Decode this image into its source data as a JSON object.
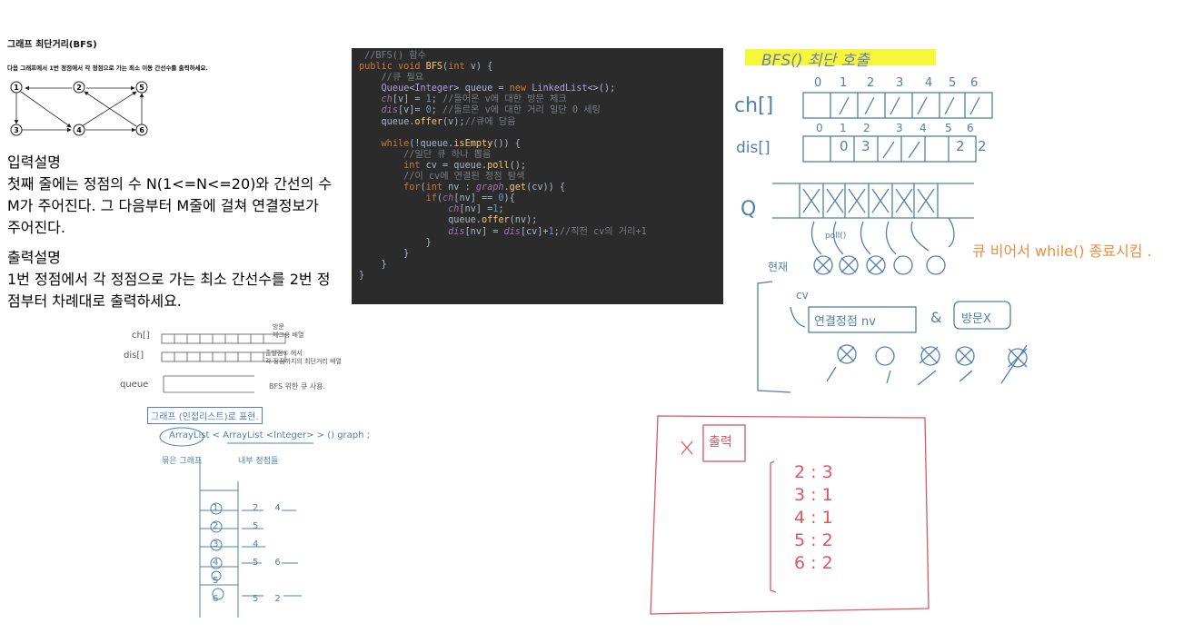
{
  "problem": {
    "title": "그래프 최단거리(BFS)",
    "description": "다음 그래프에서 1번 정점에서 각 정점으로 가는 최소 이동 간선수를 출력하세요.",
    "nodes": [
      "1",
      "2",
      "5",
      "3",
      "4",
      "6"
    ],
    "input_heading": "입력설명",
    "input_text": "첫째 줄에는 정점의 수 N(1<=N<=20)와 간선의 수 M가 주어진다. 그 다음부터 M줄에 걸쳐 연결정보가 주어진다.",
    "output_heading": "출력설명",
    "output_text": "1번 정점에서 각 정점으로 가는 최소 간선수를 2번 정점부터 차례대로 출력하세요."
  },
  "code": {
    "lines": [
      "//BFS() 함수",
      "public void BFS(int v) {",
      "    //큐 필요",
      "    Queue<Integer> queue = new LinkedList<>();",
      "    ch[v] = 1; //들어온 v에 대한 방문 체크",
      "    dis[v]= 0; //들르온 v에 대한 거리 일단 0 세팅",
      "    queue.offer(v);//큐에 담음",
      "",
      "    while(!queue.isEmpty()) {",
      "        //일단 큐 하나 뽑음",
      "        int cv = queue.poll();",
      "        //이 cv에 연결된 정점 탐색",
      "        for(int nv : graph.get(cv)) {",
      "            if(ch[nv] == 0){",
      "                ch[nv] =1;",
      "                queue.offer(nv);",
      "                dis[nv] = dis[cv]+1;//직전 cv의 거리+1",
      "            }",
      "        }",
      "    }",
      "}"
    ]
  },
  "notes_right": {
    "title": "BFS() 최단 호출",
    "index_row": [
      "0",
      "1",
      "2",
      "3",
      "4",
      "5",
      "6"
    ],
    "ch_label": "ch[]",
    "dis_label": "dis[]",
    "dis_values": [
      "",
      "0",
      "3",
      "/",
      "/",
      "2",
      "2"
    ],
    "q_label": "Q",
    "poll_label": "poll()",
    "current_label": "현재",
    "cv_label": "cv",
    "adjacent_label": "연결정점 nv",
    "and_label": "&",
    "unvisited_label": "방문X",
    "queue_empty_note": "큐 비어서 while() 종료시킴 ."
  },
  "notes_left": {
    "ch_label": "ch[]",
    "ch_note_1": "방문",
    "ch_note_2": "체크용 배열",
    "dis_label": "dis[]",
    "dis_note_1": "출발점① 에서",
    "dis_note_2": "각 정점까지의 최단거리 배열",
    "queue_label": "queue",
    "queue_note": "BFS 위한 큐 사용.",
    "list_title": "그래프 (인접리스트)로 표현.",
    "arraylist_line": "ArrayList < ArrayList <Integer> > () graph ;",
    "outer_label": "묶은 그래프",
    "inner_label": "내부 정점들",
    "adj_rows": [
      {
        "node": "1",
        "edges": [
          "2",
          "4"
        ]
      },
      {
        "node": "2",
        "edges": [
          "5"
        ]
      },
      {
        "node": "3",
        "edges": [
          "4"
        ]
      },
      {
        "node": "4",
        "edges": [
          "5",
          "6"
        ]
      },
      {
        "node": "5",
        "edges": []
      },
      {
        "node": "6",
        "edges": [
          "5",
          "2"
        ]
      }
    ]
  },
  "output_box": {
    "label": "출력",
    "results": [
      "2 : 3",
      "3 : 1",
      "4 : 1",
      "5 : 2",
      "6 : 2"
    ]
  }
}
